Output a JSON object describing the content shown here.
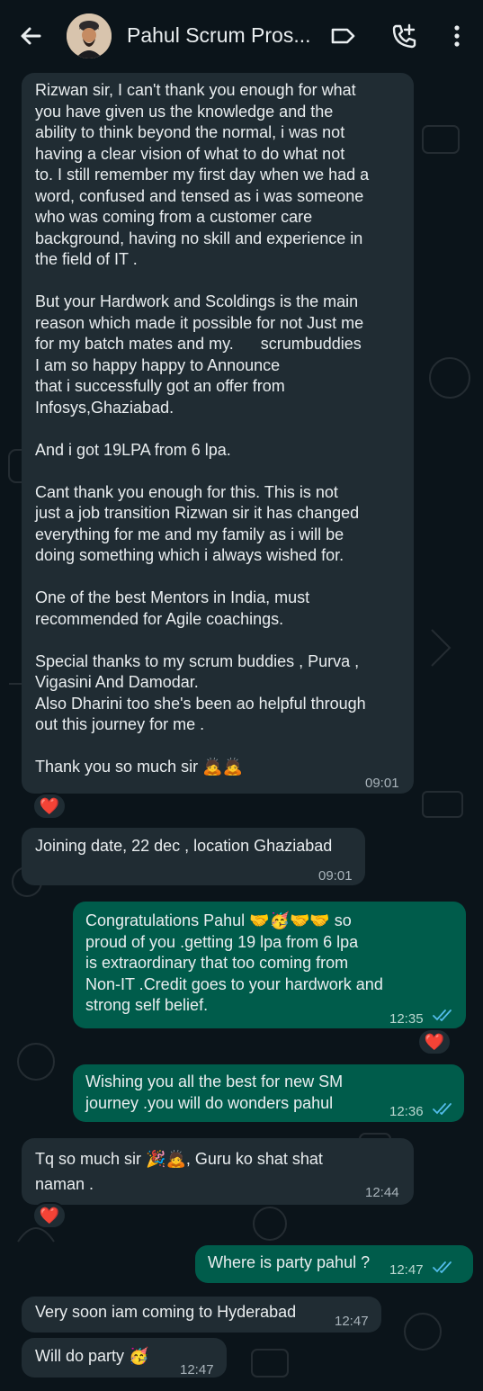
{
  "header": {
    "title": "Pahul Scrum Pros...",
    "back_icon": "arrow-left-icon",
    "label_icon": "label-tag-icon",
    "call_icon": "add-call-icon",
    "menu_icon": "more-vertical-icon"
  },
  "colors": {
    "background": "#0b141a",
    "incoming_bubble": "#202c33",
    "outgoing_bubble": "#005c4b",
    "read_ticks": "#53bdeb",
    "reaction_heart": "#e0245e"
  },
  "messages": [
    {
      "direction": "in",
      "text": "Rizwan sir, I can't thank you enough for what\nyou have given us the knowledge and the\nability to think beyond the normal, i was not\nhaving a clear vision of what to do what not\nto. I still remember my first day when we had a\nword, confused and tensed as i was someone\nwho was coming from a customer care\nbackground, having no skill and experience in\nthe field of IT .\n\nBut your Hardwork and Scoldings is the main\nreason which made it possible for not Just me\nfor my batch mates and my.      scrumbuddies\nI am so happy happy to Announce\nthat i successfully got an offer from\nInfosys,Ghaziabad.\n\nAnd i got 19LPA from 6 lpa.\n\nCant thank you enough for this. This is not\njust a job transition Rizwan sir it has changed\neverything for me and my family as i will be\ndoing something which i always wished for.\n\nOne of the best Mentors in India, must\nrecommended for Agile coachings.\n\nSpecial thanks to my scrum buddies , Purva ,\nVigasini And Damodar.\nAlso Dharini too she's been ao helpful through\nout this journey for me .\n\nThank you so much sir 🙇🙇",
      "time": "09:01",
      "reaction": "❤️"
    },
    {
      "direction": "in",
      "text": "Joining date, 22 dec , location Ghaziabad",
      "time": "09:01"
    },
    {
      "direction": "out",
      "text": "Congratulations Pahul 🤝🥳🤝🤝 so\nproud of you .getting 19 lpa from 6 lpa\nis extraordinary that too coming from\nNon-IT .Credit goes to your hardwork and\nstrong self belief.",
      "time": "12:35",
      "reaction": "❤️"
    },
    {
      "direction": "out",
      "text": "Wishing you all the best for new SM\njourney .you will do wonders pahul",
      "time": "12:36"
    },
    {
      "direction": "in",
      "text": "Tq so much sir 🎉🙇, Guru ko shat shat\nnaman .",
      "time": "12:44",
      "reaction": "❤️"
    },
    {
      "direction": "out",
      "text": "Where is party pahul ?",
      "time": "12:47"
    },
    {
      "direction": "in",
      "text": "Very soon iam coming to Hyderabad",
      "time": "12:47"
    },
    {
      "direction": "in",
      "text": "Will do party 🥳",
      "time": "12:47"
    }
  ]
}
